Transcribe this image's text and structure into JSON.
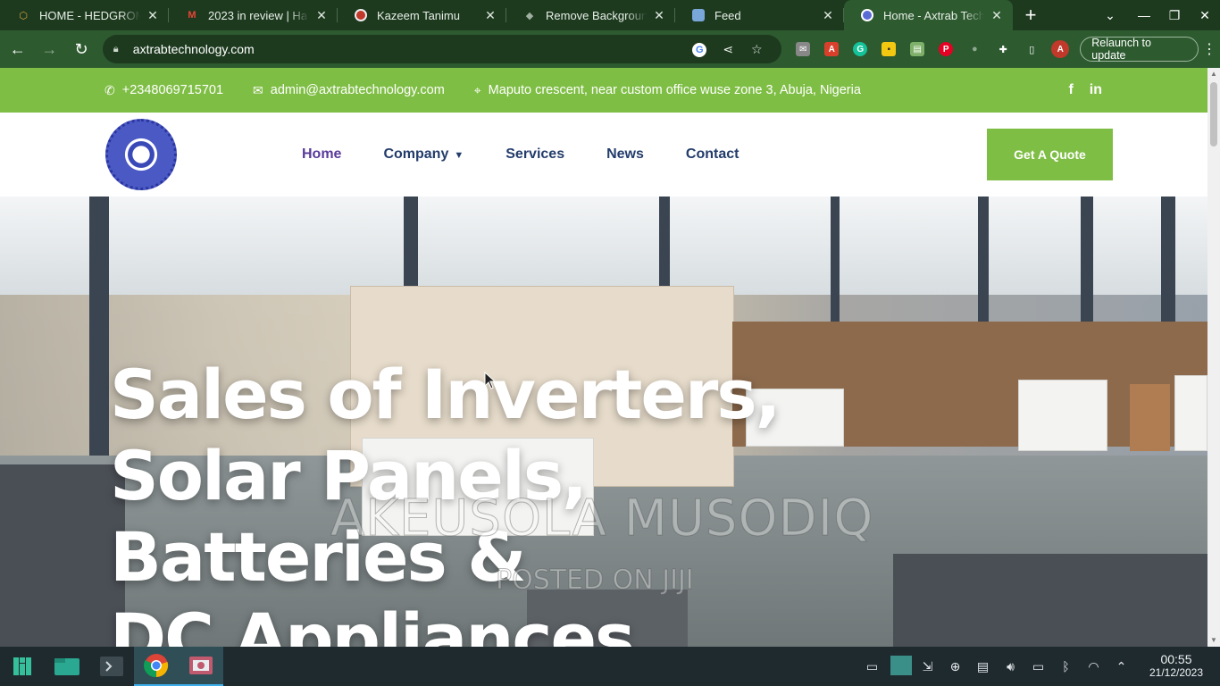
{
  "browser": {
    "tabs": [
      {
        "title": "HOME - HEDGROMI",
        "favicon": "hexagon-icon",
        "color": "#d9a441"
      },
      {
        "title": "2023 in review | Ha",
        "favicon": "gmail-icon",
        "color": "#ea4335"
      },
      {
        "title": "Kazeem Tanimu",
        "favicon": "profile-icon",
        "color": "#c0392b"
      },
      {
        "title": "Remove Backgroun",
        "favicon": "layers-icon",
        "color": "#9fb0a0"
      },
      {
        "title": "Feed",
        "favicon": "feed-icon",
        "color": "#7aa7d9"
      },
      {
        "title": "Home - Axtrab Tech",
        "favicon": "site-logo-icon",
        "color": "#5b6bd6",
        "active": true
      }
    ],
    "url": "axtrabtechnology.com",
    "relaunch_label": "Relaunch to update",
    "profile_initial": "A"
  },
  "site": {
    "topbar": {
      "phone": "+2348069715701",
      "email": "admin@axtrabtechnology.com",
      "address": "Maputo crescent, near custom office wuse zone 3, Abuja, Nigeria",
      "social": [
        "f",
        "in"
      ]
    },
    "nav": {
      "items": [
        "Home",
        "Company",
        "Services",
        "News",
        "Contact"
      ],
      "active": "Home",
      "cta": "Get A Quote"
    },
    "hero": {
      "headline_lines": [
        "Sales of Inverters,",
        "Solar Panels,",
        "Batteries &",
        "DC Appliances"
      ],
      "watermark_name": "AKEUSOLA MUSODIQ",
      "watermark_sub": "POSTED ON JIJI"
    }
  },
  "taskbar": {
    "time": "00:55",
    "date": "21/12/2023"
  },
  "colors": {
    "brand_green": "#7fbe45",
    "nav_text": "#233c6b",
    "nav_active": "#5a3a9a",
    "chrome_dark": "#1d3a1f",
    "chrome_toolbar": "#2d5a2f"
  }
}
